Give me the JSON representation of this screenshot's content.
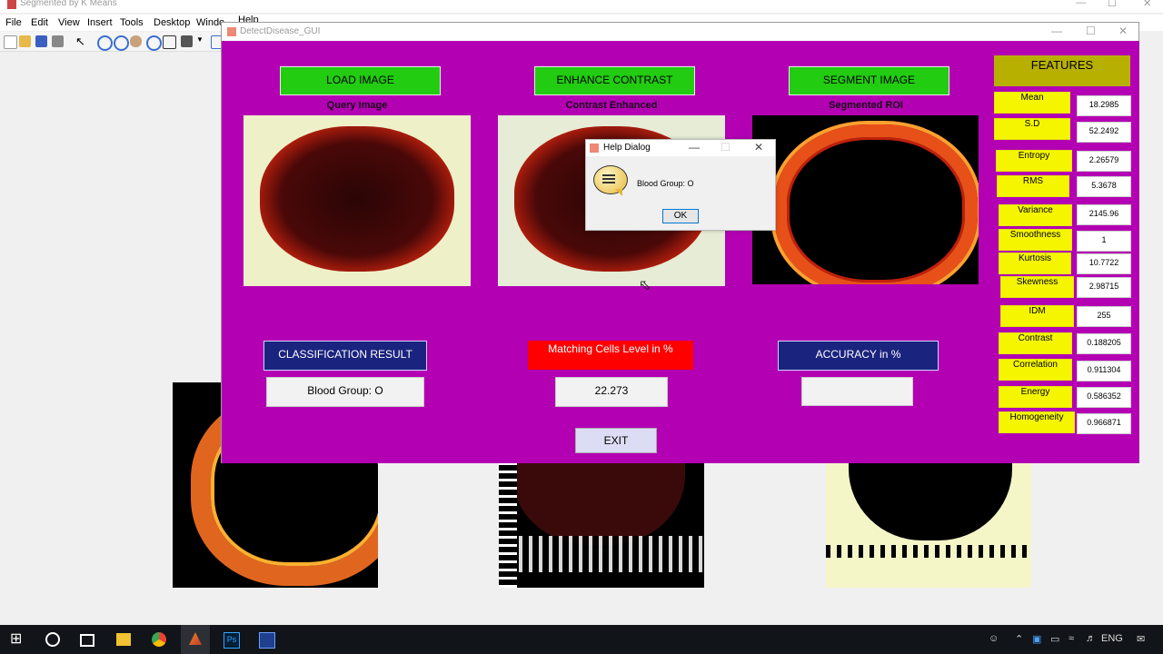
{
  "background_window": {
    "title": "Segmented by K Means",
    "menu": [
      "File",
      "Edit",
      "View",
      "Insert",
      "Tools",
      "Desktop",
      "Windo",
      "Help"
    ]
  },
  "gui": {
    "title": "DetectDisease_GUI",
    "buttons": {
      "load_image": "LOAD IMAGE",
      "enhance_contrast": "ENHANCE CONTRAST",
      "segment_image": "SEGMENT IMAGE",
      "classification_result": "CLASSIFICATION RESULT",
      "accuracy": "ACCURACY in %",
      "exit": "EXIT"
    },
    "axes_titles": {
      "query": "Query Image",
      "contrast": "Contrast Enhanced",
      "segmented": "Segmented ROI"
    },
    "matching_label": "Matching Cells Level  in %",
    "results": {
      "classification": "Blood Group: O",
      "matching": "22.273",
      "accuracy": ""
    },
    "features_title": "FEATURES",
    "features": [
      {
        "label": "Mean",
        "value": "18.2985"
      },
      {
        "label": "S.D",
        "value": "52.2492"
      },
      {
        "label": "Entropy",
        "value": "2.26579"
      },
      {
        "label": "RMS",
        "value": "5.3678"
      },
      {
        "label": "Variance",
        "value": "2145.96"
      },
      {
        "label": "Smoothness",
        "value": "1"
      },
      {
        "label": "Kurtosis",
        "value": "10.7722"
      },
      {
        "label": "Skewness",
        "value": "2.98715"
      },
      {
        "label": "IDM",
        "value": "255"
      },
      {
        "label": "Contrast",
        "value": "0.188205"
      },
      {
        "label": "Correlation",
        "value": "0.911304"
      },
      {
        "label": "Energy",
        "value": "0.586352"
      },
      {
        "label": "Homogeneity",
        "value": "0.966871"
      }
    ]
  },
  "dialog": {
    "title": "Help Dialog",
    "message": "Blood Group: O",
    "ok": "OK"
  },
  "taskbar": {
    "lang": "ENG"
  },
  "colors": {
    "gui_background": "#b300b3",
    "green_button": "#22cc11",
    "blue_button": "#1a237e",
    "matching_label_bg": "#ff0000",
    "feature_label_bg": "#f5f500",
    "features_header_bg": "#b8b000"
  }
}
